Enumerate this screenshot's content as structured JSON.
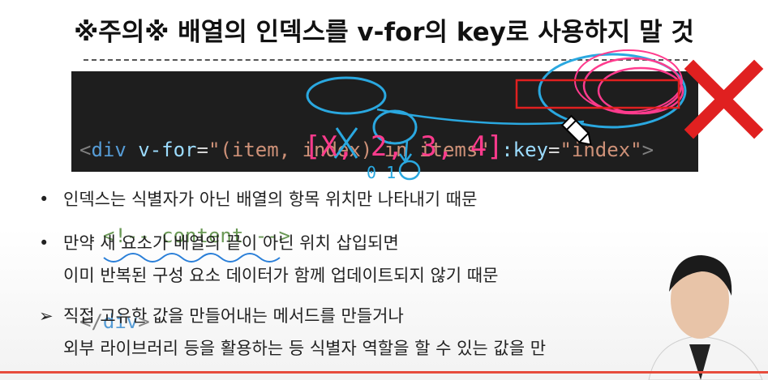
{
  "title": "※주의※ 배열의 인덱스를 v-for의 key로 사용하지 말 것",
  "code": {
    "line1": {
      "open": "<",
      "tag": "div",
      "attr": " v-for",
      "eq": "=",
      "str": "\"(item, index) in items\"",
      "space": " ",
      "key_attr": ":key",
      "key_eq": "=",
      "key_val": "\"index\"",
      "close": ">"
    },
    "line2": {
      "comment": "<!-- content -->"
    },
    "line3": {
      "open": "</",
      "tag": "div",
      "close": ">"
    }
  },
  "annotation": {
    "array_text": "[X, 2, 3, 4]",
    "below_text": "0  1"
  },
  "bullets": [
    {
      "mark": "•",
      "lines": [
        "인덱스는 식별자가 아닌 배열의 항목 위치만 나타내기 때문"
      ]
    },
    {
      "mark": "•",
      "lines": [
        "만약 새 요소가 배열의 끝이 아닌 위치 삽입되면",
        "이미 반복된 구성 요소 데이터가 함께 업데이트되지 않기 때문"
      ]
    },
    {
      "mark": "➢",
      "lines": [
        "직접 고유한 값을 만들어내는 메서드를 만들거나",
        "외부 라이브러리 등을 활용하는 등 식별자 역할을 할 수 있는 값을 만"
      ]
    }
  ],
  "colors": {
    "accent_red": "#e02020",
    "annotation_blue": "#2aa8e0",
    "annotation_pink": "#ff3b8d"
  }
}
